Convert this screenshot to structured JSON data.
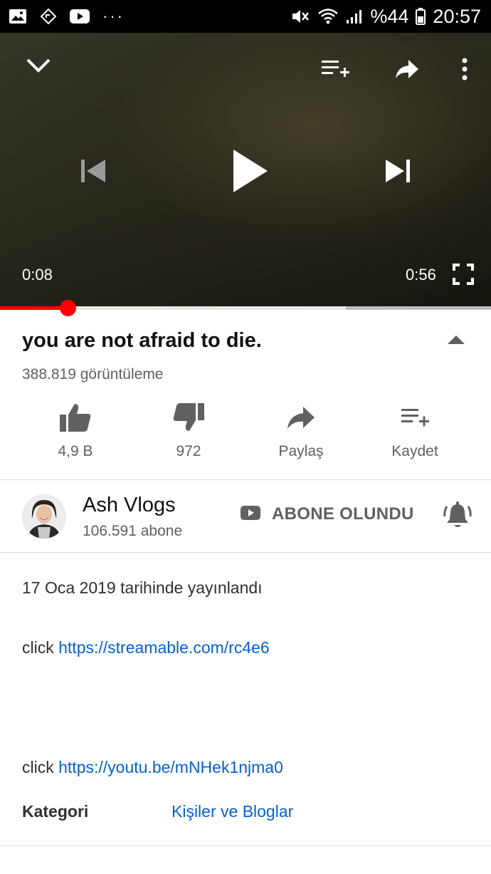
{
  "status_bar": {
    "left_icons": [
      "image-icon",
      "navigation-icon",
      "youtube-icon"
    ],
    "overflow": "···",
    "battery": "%44",
    "time": "20:57"
  },
  "player": {
    "current_time": "0:08",
    "duration": "0:56",
    "progress_fraction": 0.138,
    "buffered_fraction": 0.704,
    "accent": "#ff0000"
  },
  "video": {
    "title": "you are not afraid to die.",
    "views": "388.819 görüntüleme"
  },
  "actions": {
    "like_count": "4,9 B",
    "dislike_count": "972",
    "share_label": "Paylaş",
    "save_label": "Kaydet"
  },
  "channel": {
    "name": "Ash Vlogs",
    "subscribers": "106.591 abone",
    "subscribed_label": "ABONE OLUNDU"
  },
  "description": {
    "published": "17 Oca 2019 tarihinde yayınlandı",
    "line1_prefix": "click",
    "line1_link": "https://streamable.com/rc4e6",
    "line2_prefix": "click",
    "line2_link": "https://youtu.be/mNHek1njma0",
    "category_label": "Kategori",
    "category_value": "Kişiler ve Bloglar"
  },
  "colors": {
    "link": "#065fd4",
    "secondary_text": "#606060",
    "brand_red": "#ff0000"
  }
}
